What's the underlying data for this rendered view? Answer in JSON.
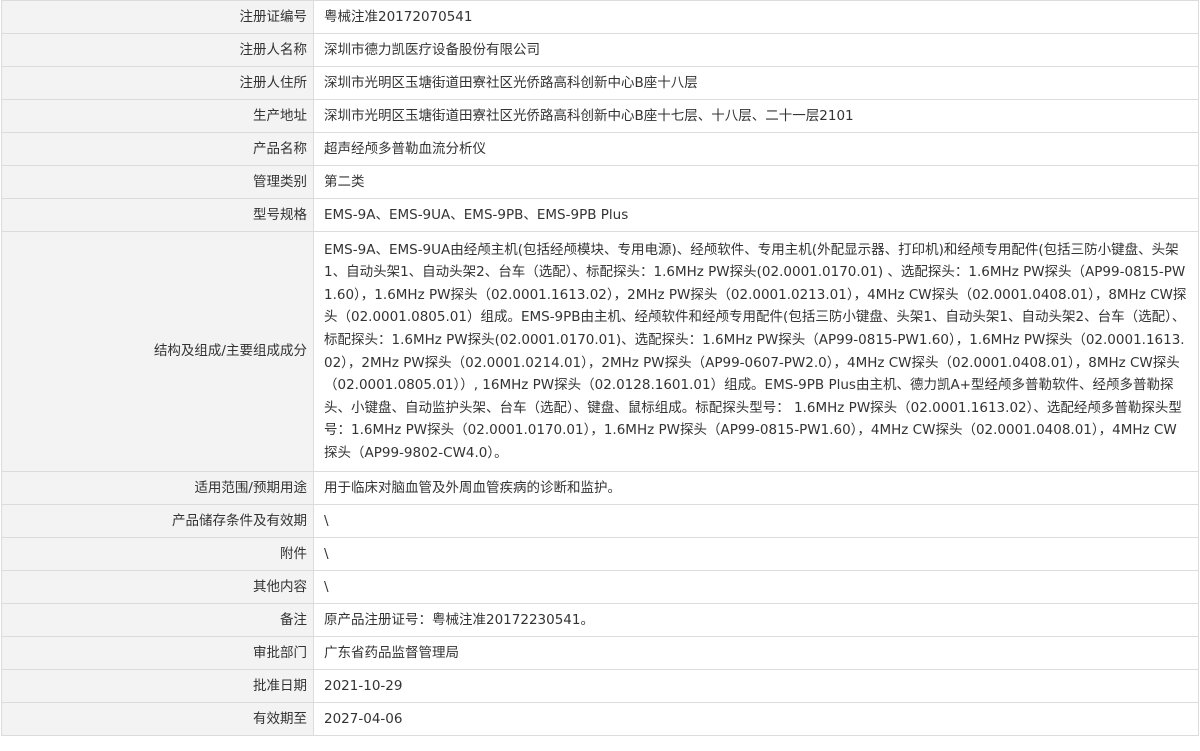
{
  "rows": [
    {
      "label": "注册证编号",
      "value": "粤械注准20172070541"
    },
    {
      "label": "注册人名称",
      "value": "深圳市德力凯医疗设备股份有限公司"
    },
    {
      "label": "注册人住所",
      "value": "深圳市光明区玉塘街道田寮社区光侨路高科创新中心B座十八层"
    },
    {
      "label": "生产地址",
      "value": "深圳市光明区玉塘街道田寮社区光侨路高科创新中心B座十七层、十八层、二十一层2101"
    },
    {
      "label": "产品名称",
      "value": "超声经颅多普勒血流分析仪"
    },
    {
      "label": "管理类别",
      "value": "第二类"
    },
    {
      "label": "型号规格",
      "value": "EMS-9A、EMS-9UA、EMS-9PB、EMS-9PB Plus"
    },
    {
      "label": "结构及组成/主要组成成分",
      "value": "EMS-9A、EMS-9UA由经颅主机(包括经颅模块、专用电源)、经颅软件、专用主机(外配显示器、打印机)和经颅专用配件(包括三防小键盘、头架1、自动头架1、自动头架2、台车（选配）、标配探头：1.6MHz PW探头(02.0001.0170.01) 、选配探头：1.6MHz PW探头（AP99-0815-PW1.60），1.6MHz PW探头（02.0001.1613.02），2MHz PW探头（02.0001.0213.01），4MHz CW探头（02.0001.0408.01），8MHz CW探头（02.0001.0805.01）组成。EMS-9PB由主机、经颅软件和经颅专用配件(包括三防小键盘、头架1、自动头架1、自动头架2、台车（选配）、标配探头：1.6MHz PW探头(02.0001.0170.01)、选配探头：1.6MHz PW探头（AP99-0815-PW1.60），1.6MHz PW探头（02.0001.1613.02），2MHz PW探头（02.0001.0214.01），2MHz PW探头（AP99-0607-PW2.0），4MHz CW探头（02.0001.0408.01），8MHz CW探头（02.0001.0805.01））, 16MHz PW探头（02.0128.1601.01）组成。EMS-9PB Plus由主机、德力凯A+型经颅多普勒软件、经颅多普勒探头、小键盘、自动监护头架、台车（选配）、键盘、鼠标组成。标配探头型号： 1.6MHz PW探头（02.0001.1613.02）、选配经颅多普勒探头型号：1.6MHz PW探头（02.0001.0170.01），1.6MHz PW探头（AP99-0815-PW1.60），4MHz CW探头（02.0001.0408.01），4MHz CW探头（AP99-9802-CW4.0）。"
    },
    {
      "label": "适用范围/预期用途",
      "value": "用于临床对脑血管及外周血管疾病的诊断和监护。"
    },
    {
      "label": "产品储存条件及有效期",
      "value": "\\"
    },
    {
      "label": "附件",
      "value": "\\"
    },
    {
      "label": "其他内容",
      "value": "\\"
    },
    {
      "label": "备注",
      "value": "原产品注册证号：粤械注准20172230541。"
    },
    {
      "label": "审批部门",
      "value": "广东省药品监督管理局"
    },
    {
      "label": "批准日期",
      "value": "2021-10-29"
    },
    {
      "label": "有效期至",
      "value": "2027-04-06"
    }
  ]
}
